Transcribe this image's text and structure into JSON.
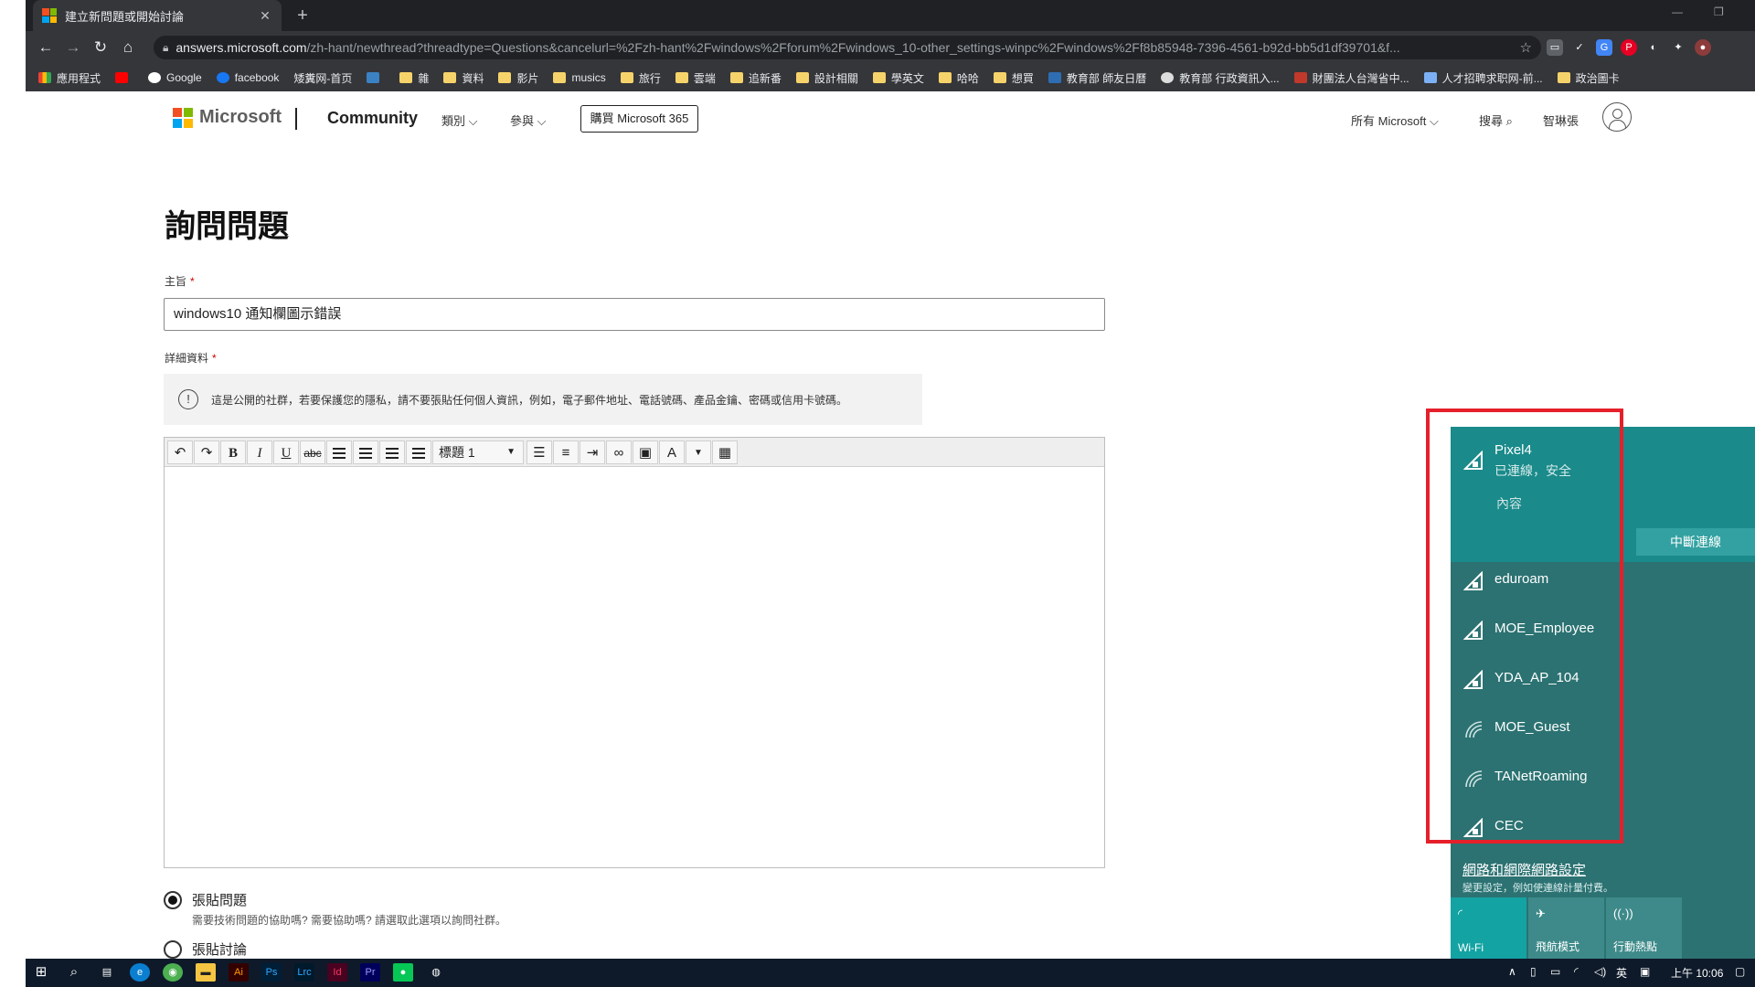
{
  "browser": {
    "tab_title": "建立新問題或開始討論",
    "tab_close": "✕",
    "new_tab": "+",
    "url_host": "answers.microsoft.com",
    "url_path": "/zh-hant/newthread?threadtype=Questions&cancelurl=%2Fzh-hant%2Fwindows%2Fforum%2Fwindows_10-other_settings-winpc%2Fwindows%2Ff8b85948-7396-4561-b92d-bb5d1df39701&f...",
    "bookmarks": [
      "應用程式",
      "Google",
      "facebook",
      "矮糞网-首页",
      "雜",
      "資料",
      "影片",
      "musics",
      "旅行",
      "雲端",
      "追新番",
      "設計相關",
      "學英文",
      "哈哈",
      "想買",
      "教育部 師友日曆",
      "教育部 行政資訊入...",
      "財團法人台灣省中...",
      "人才招聘求职网-前...",
      "政治圖卡"
    ]
  },
  "site": {
    "brand": "Microsoft",
    "community": "Community",
    "nav_categories": "類別",
    "nav_participate": "參與",
    "buy_button": "購買 Microsoft 365",
    "all_microsoft": "所有 Microsoft",
    "search": "搜尋",
    "user": "智琳張"
  },
  "form": {
    "page_title": "詢問問題",
    "subject_label": "主旨",
    "subject_value": "windows10 通知欄圖示錯誤",
    "details_label": "詳細資料",
    "required_mark": "*",
    "privacy_notice": "這是公開的社群，若要保護您的隱私，請不要張貼任何個人資訊，例如，電子郵件地址、電話號碼、產品金鑰、密碼或信用卡號碼。",
    "heading_select": "標題 1",
    "post_question_label": "張貼問題",
    "post_question_desc": "需要技術問題的協助嗎? 需要協助嗎? 請選取此選項以詢問社群。",
    "post_discussion_label": "張貼討論"
  },
  "network_flyout": {
    "active": {
      "name": "Pixel4",
      "status": "已連線，安全",
      "properties": "內容",
      "disconnect": "中斷連線"
    },
    "networks": [
      "eduroam",
      "MOE_Employee",
      "YDA_AP_104",
      "MOE_Guest",
      "TANetRoaming",
      "CEC"
    ],
    "settings_link": "網路和網際網路設定",
    "settings_desc": "變更設定，例如使連線計量付費。",
    "quick_actions": [
      "Wi-Fi",
      "飛航模式",
      "行動熱點"
    ],
    "highlight_color": "#e5202a"
  },
  "taskbar": {
    "ime": "英",
    "clock": "上午 10:06"
  },
  "colors": {
    "flyout": "#2c7272",
    "flyout_active": "#1a8a8a",
    "accent_button": "#33a1a1"
  }
}
